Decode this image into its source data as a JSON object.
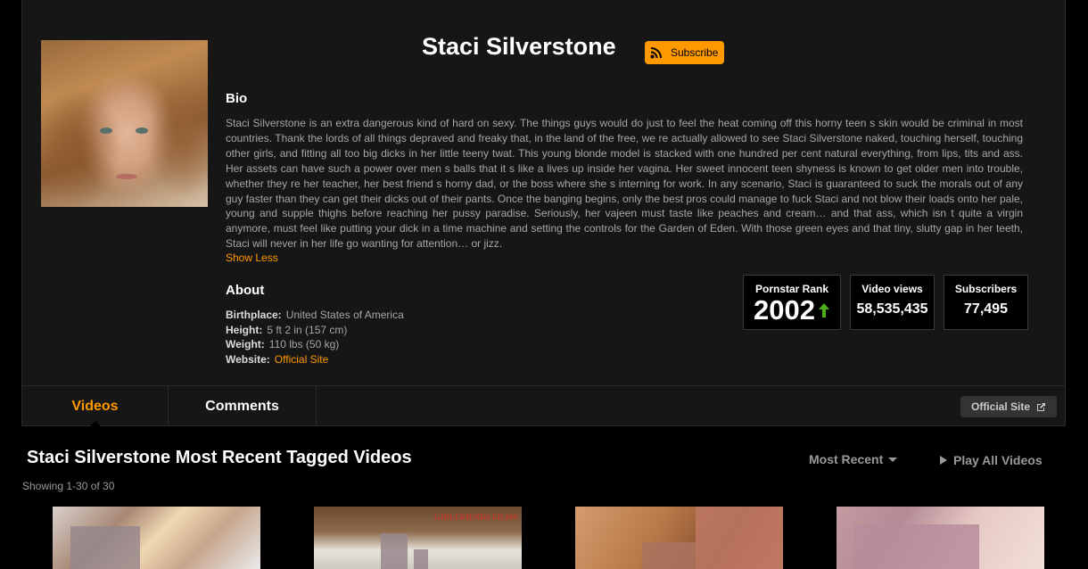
{
  "profile": {
    "name": "Staci Silverstone",
    "subscribe_label": "Subscribe",
    "bio_heading": "Bio",
    "bio_text": "Staci Silverstone is an extra dangerous kind of hard on sexy. The things guys would do just to feel the heat coming off this horny teen s skin would be criminal in most countries. Thank the lords of all things depraved and freaky that, in the land of the free, we re actually allowed to see Staci Silverstone naked, touching herself, touching other girls, and fitting all too big dicks in her little teeny twat. This young blonde model is stacked with one hundred per cent natural everything, from lips, tits and ass. Her assets can have such a power over men s balls that it s like a lives up inside her vagina. Her sweet innocent teen shyness is known to get older men into trouble, whether they re her teacher, her best friend s horny dad, or the boss where she s interning for work. In any scenario, Staci is guaranteed to suck the morals out of any guy faster than they can get their dicks out of their pants. Once the banging begins, only the best pros could manage to fuck Staci and not blow their loads onto her pale, young and supple thighs before reaching her pussy paradise. Seriously, her vajeen must taste like peaches and cream… and that ass, which isn t quite a virgin anymore, must feel like putting your dick in a time machine and setting the controls for the Garden of Eden. With those green eyes and that tiny, slutty gap in her teeth, Staci will never in her life go wanting for attention… or jizz.",
    "show_less": "Show Less",
    "about_heading": "About",
    "about": {
      "birthplace_label": "Birthplace:",
      "birthplace": "United States of America",
      "height_label": "Height:",
      "height": "5 ft 2 in (157 cm)",
      "weight_label": "Weight:",
      "weight": "110 lbs (50 kg)",
      "website_label": "Website:",
      "website": "Official Site"
    },
    "stats": {
      "rank_label": "Pornstar Rank",
      "rank": "2002",
      "views_label": "Video views",
      "views": "58,535,435",
      "subs_label": "Subscribers",
      "subs": "77,495"
    },
    "accent_color": "#ff9900",
    "rank_trend_color": "#4caf1a"
  },
  "tabs": [
    {
      "label": "Videos",
      "active": true
    },
    {
      "label": "Comments",
      "active": false
    }
  ],
  "official_site_button": "Official Site",
  "videos_section": {
    "title": "Staci Silverstone Most Recent Tagged Videos",
    "showing": "Showing 1-30 of 30",
    "sort_label": "Most Recent",
    "play_all": "Play All Videos",
    "thumbnail_watermark": "GIRLFRIENDS FILMS"
  },
  "icons": {
    "subscribe": "rss-icon",
    "rank_trend": "arrow-up-icon",
    "official_site": "external-link-icon",
    "sort": "caret-down-icon",
    "play_all": "play-icon"
  }
}
